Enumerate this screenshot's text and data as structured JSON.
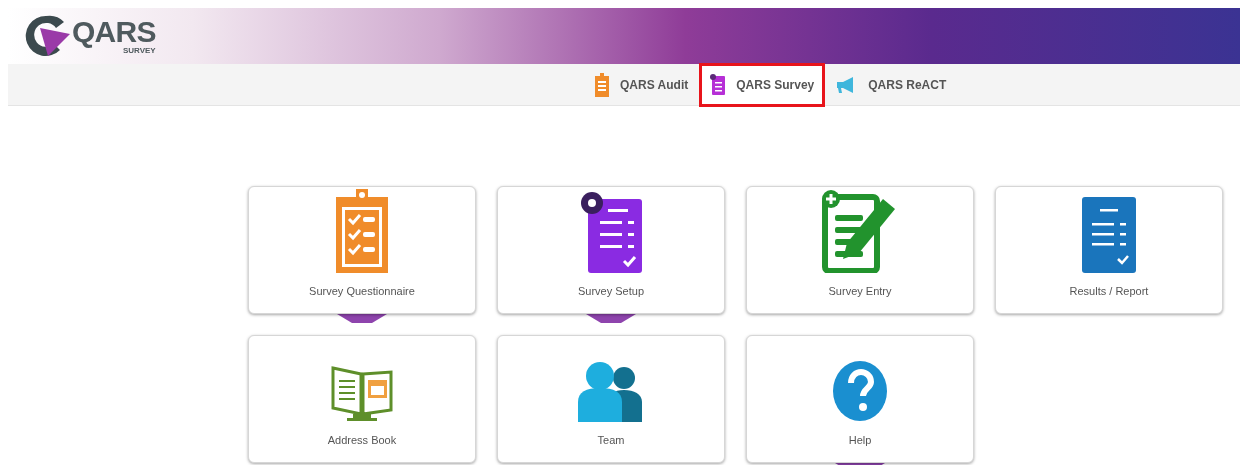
{
  "logo": {
    "title": "QARS",
    "subtitle": "SURVEY"
  },
  "nav_tabs": [
    {
      "label": "QARS Audit",
      "kind": "clipboard",
      "selected": false
    },
    {
      "label": "QARS Survey",
      "kind": "document",
      "selected": true
    },
    {
      "label": "QARS ReACT",
      "kind": "megaphone",
      "selected": false
    }
  ],
  "tiles": [
    {
      "label": "Survey Questionnaire",
      "kind": "clipboard-check",
      "pointer": true
    },
    {
      "label": "Survey Setup",
      "kind": "document-gear",
      "pointer": true
    },
    {
      "label": "Survey Entry",
      "kind": "document-pencil",
      "pointer": false
    },
    {
      "label": "Results / Report",
      "kind": "document-check",
      "pointer": false
    },
    {
      "label": "Address Book",
      "kind": "book",
      "pointer": false
    },
    {
      "label": "Team",
      "kind": "people",
      "pointer": false
    },
    {
      "label": "Help",
      "kind": "help",
      "pointer": true
    }
  ]
}
